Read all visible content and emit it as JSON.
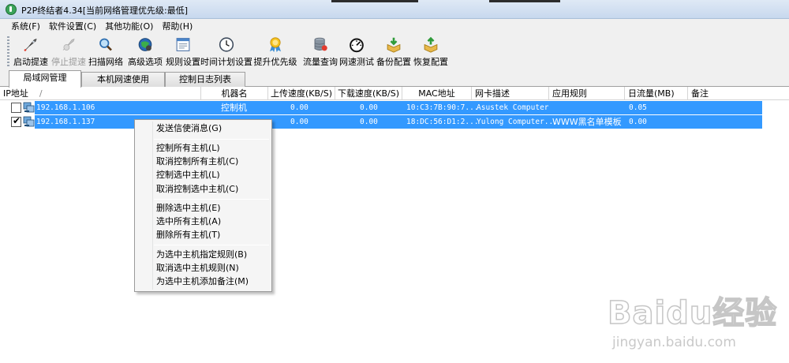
{
  "window": {
    "title": "P2P终结者4.34[当前网络管理优先级:最低]"
  },
  "menu": [
    "系统(F)",
    "软件设置(C)",
    "其他功能(O)",
    "帮助(H)"
  ],
  "toolbar": [
    {
      "label": "启动提速",
      "icon": "rocket-icon",
      "enabled": true
    },
    {
      "label": "停止提速",
      "icon": "rocket-stop-icon",
      "enabled": false
    },
    {
      "label": "扫描网络",
      "icon": "magnifier-icon",
      "enabled": true
    },
    {
      "label": "高级选项",
      "icon": "globe-icon",
      "enabled": true
    },
    {
      "label": "规则设置",
      "icon": "rules-window-icon",
      "enabled": true
    },
    {
      "label": "时间计划设置",
      "icon": "clock-icon",
      "enabled": true
    },
    {
      "label": "提升优先级",
      "icon": "medal-icon",
      "enabled": true
    },
    {
      "label": "流量查询",
      "icon": "database-icon",
      "enabled": true
    },
    {
      "label": "网速测试",
      "icon": "speedometer-icon",
      "enabled": true
    },
    {
      "label": "备份配置",
      "icon": "backup-box-icon",
      "enabled": true
    },
    {
      "label": "恢复配置",
      "icon": "restore-box-icon",
      "enabled": true
    }
  ],
  "tabs": [
    {
      "label": "局域网管理",
      "active": true
    },
    {
      "label": "本机网速使用",
      "active": false
    },
    {
      "label": "控制日志列表",
      "active": false
    }
  ],
  "columns": {
    "ip": "IP地址",
    "sort": "/",
    "name": "机器名",
    "up": "上传速度(KB/S)",
    "down": "下载速度(KB/S)",
    "mac": "MAC地址",
    "nic": "网卡描述",
    "rule": "应用规则",
    "traffic": "日流量(MB)",
    "note": "备注"
  },
  "rows": [
    {
      "checked": false,
      "ip": "192.168.1.106",
      "name": "控制机",
      "up": "0.00",
      "down": "0.00",
      "mac": "10:C3:7B:90:7...",
      "nic": "Asustek Computer",
      "rule": "",
      "traffic": "0.05",
      "note": ""
    },
    {
      "checked": true,
      "ip": "192.168.1.137",
      "name": "",
      "up": "0.00",
      "down": "0.00",
      "mac": "18:DC:56:D1:2...",
      "nic": "Yulong Computer...",
      "rule": "WWW黑名单模板",
      "traffic": "0.00",
      "note": ""
    }
  ],
  "context_menu": {
    "groups": [
      [
        "发送信使消息(G)"
      ],
      [
        "控制所有主机(L)",
        "取消控制所有主机(C)",
        "控制选中主机(L)",
        "取消控制选中主机(C)"
      ],
      [
        "删除选中主机(E)",
        "选中所有主机(A)",
        "删除所有主机(T)"
      ],
      [
        "为选中主机指定规则(B)",
        "取消选中主机规则(N)",
        "为选中主机添加备注(M)"
      ]
    ]
  },
  "watermark": {
    "brand": "Baidu经验",
    "url": "jingyan.baidu.com"
  },
  "colors": {
    "selection": "#3399ff",
    "menu_bg": "#f0f0f0"
  }
}
